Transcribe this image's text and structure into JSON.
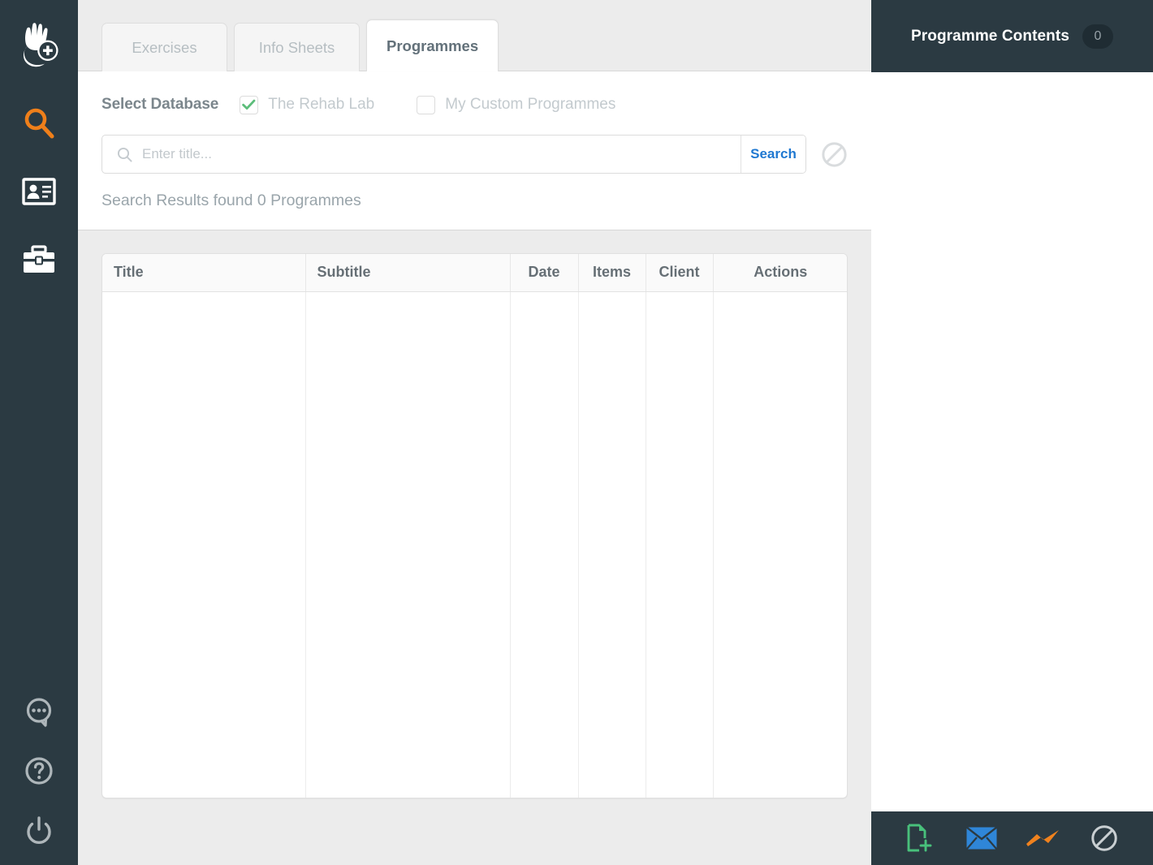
{
  "app": {
    "brand_icon": "hand-plus-logo-icon",
    "accent_orange": "#ef7f1a",
    "sidebar_bg": "#2b3a42",
    "page_bg": "#ececec"
  },
  "sidebar": {
    "logo": {
      "name": "hand-plus-logo-icon",
      "label": "The Rehab Lab"
    },
    "items": [
      {
        "name": "search-nav-icon",
        "label": "Search",
        "color": "#ef7f1a",
        "active": true
      },
      {
        "name": "id-card-nav-icon",
        "label": "Clients",
        "color": "#ffffff",
        "active": false
      },
      {
        "name": "briefcase-nav-icon",
        "label": "Toolkit",
        "color": "#ffffff",
        "active": false
      }
    ],
    "bottom_items": [
      {
        "name": "chat-bubble-icon",
        "label": "Chat",
        "color": "#aeb6ba"
      },
      {
        "name": "help-circle-icon",
        "label": "Help",
        "color": "#aeb6ba"
      },
      {
        "name": "power-icon",
        "label": "Logout",
        "color": "#aeb6ba"
      }
    ]
  },
  "tabs": [
    {
      "label": "Exercises",
      "active": false
    },
    {
      "label": "Info Sheets",
      "active": false
    },
    {
      "label": "Programmes",
      "active": true
    }
  ],
  "search_panel": {
    "database_label": "Select Database",
    "databases": [
      {
        "label": "The Rehab Lab",
        "checked": true
      },
      {
        "label": "My Custom Programmes",
        "checked": false
      }
    ],
    "checkbox_check_color": "#5cbd7a",
    "input_value": "",
    "placeholder": "Enter title...",
    "search_button": "Search",
    "search_button_color": "#1f78d1",
    "clear_icon": "no-entry-icon",
    "results_text": "Search Results found 0 Programmes",
    "results_count": 0
  },
  "table": {
    "columns": [
      "Title",
      "Subtitle",
      "Date",
      "Items",
      "Client",
      "Actions"
    ],
    "rows": []
  },
  "right_panel": {
    "title": "Programme Contents",
    "count": "0",
    "footer_actions": [
      {
        "name": "new-document-icon",
        "label": "New Programme",
        "color": "#48c07b"
      },
      {
        "name": "email-icon",
        "label": "Email",
        "color": "#2f86d8"
      },
      {
        "name": "activity-icon",
        "label": "Activity",
        "color": "#f0821e"
      },
      {
        "name": "no-entry-icon",
        "label": "Clear",
        "color": "#c9cfd2"
      }
    ]
  }
}
